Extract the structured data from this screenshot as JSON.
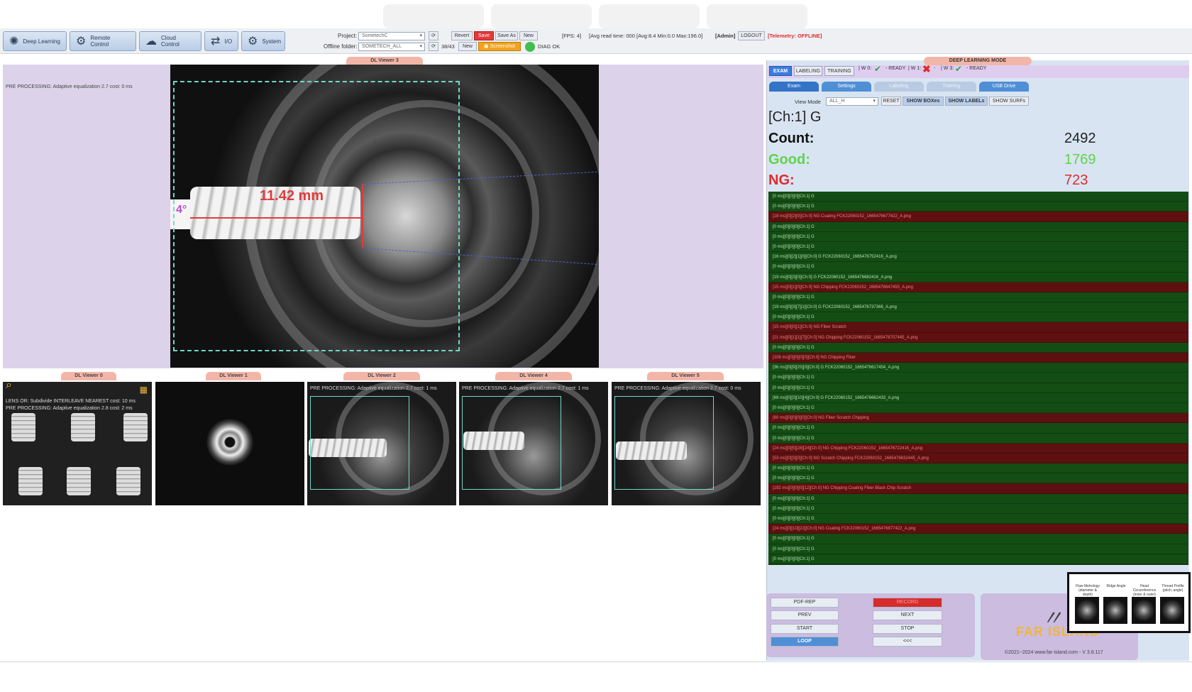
{
  "toolbar": {
    "deep_learning": "Deep Learning",
    "remote_control": "Remote Control",
    "cloud_control": "Cloud Control",
    "io": "I/O",
    "system": "System"
  },
  "project": {
    "project_label": "Project:",
    "project_value": "SometechC",
    "offline_label": "Offline folder:",
    "offline_value": "SOMETECH_ALL",
    "counter": "38/43",
    "revert": "Revert",
    "save": "Save",
    "save_as": "Save As",
    "new1": "New",
    "new2": "New",
    "screenshot": "Screenshot",
    "diag": "DIAG OK"
  },
  "status_line": {
    "fps": "[FPS: 4]",
    "avg": "[Avg read time: 000 [Avg:8.4 Min:0.0 Max:196.0]",
    "admin": "[Admin]",
    "logout": "LOGOUT",
    "telemetry": "[Telemetry: OFFLINE]"
  },
  "viewer3": {
    "tab": "DL Viewer 3",
    "preprocessing": "PRE PROCESSING: Adaptive equalization 2.7 cost: 0 ms",
    "measurement": "11.42 mm",
    "angle": "4°"
  },
  "mini_viewers": [
    {
      "tab": "DL Viewer 0",
      "pp1": "LENS OR: Subdivide INTERLEAVE NEAREST cost: 10 ms",
      "pp2": "PRE PROCESSING: Adaptive equalization 2.8 cost: 2 ms"
    },
    {
      "tab": "DL Viewer 1"
    },
    {
      "tab": "DL Viewer 2",
      "pp": "PRE PROCESSING: Adaptive equalization 2.7 cost: 1 ms"
    },
    {
      "tab": "DL Viewer 4",
      "pp": "PRE PROCESSING: Adaptive equalization 2.7 cost: 1 ms"
    },
    {
      "tab": "DL Viewer 5",
      "pp": "PRE PROCESSING: Adaptive equalization 2.7 cost: 0 ms"
    }
  ],
  "right": {
    "mode_title": "DEEP LEARNING MODE",
    "tabs": [
      "EXAM",
      "LABELING",
      "TRAINING"
    ],
    "w0": "| W 0:",
    "ready1": "- READY",
    "w1": "| W 1:",
    "dash1": "-",
    "w3": "| W 3:",
    "ready2": "- READY",
    "subtabs": [
      "Exam",
      "Settings",
      "Labeling",
      "Training",
      "USB Drive"
    ],
    "view_mode_label": "View Mode",
    "view_mode_value": "ALL_H",
    "reset": "RESET",
    "show_boxes": "SHOW BOXes",
    "show_labels": "SHOW LABELs",
    "show_surfs": "SHOW SURFs",
    "channel": "[Ch:1] G",
    "count_label": "Count:",
    "count_value": "2492",
    "good_label": "Good:",
    "good_value": "1769",
    "ng_label": "NG:",
    "ng_value": "723"
  },
  "log": [
    {
      "t": "[0 ms][0][0][0][Ch:1] G",
      "ng": false
    },
    {
      "t": "[0 ms][0][0][0][Ch:1] G",
      "ng": false
    },
    {
      "t": "[18 ms][0][2][0][Ch:0] NG Coating FCK22060152_1665476677422_A.png",
      "ng": true
    },
    {
      "t": "[0 ms][0][0][0][Ch:1] G",
      "ng": false
    },
    {
      "t": "[0 ms][0][0][0][Ch:1] G",
      "ng": false
    },
    {
      "t": "[0 ms][0][0][0][Ch:1] G",
      "ng": false
    },
    {
      "t": "[16 ms][0][2][1][0][Ch:0] G FCK22060152_1665476752416_A.png",
      "ng": false
    },
    {
      "t": "[0 ms][0][0][0][Ch:1] G",
      "ng": false
    },
    {
      "t": "[19 ms][0][3][0][Ch:0] G FCK22060152_1665476682416_A.png",
      "ng": false
    },
    {
      "t": "[15 ms][0][1][0][Ch:0] NG Chipping FCK22060152_1665476647455_A.png",
      "ng": true
    },
    {
      "t": "[0 ms][0][0][0][Ch:1] G",
      "ng": false
    },
    {
      "t": "[19 ms][0][3][7][1][Ch:0] G FCK22060152_1665476737366_A.png",
      "ng": false
    },
    {
      "t": "[0 ms][0][0][0][Ch:1] G",
      "ng": false
    },
    {
      "t": "[15 ms][0][0][1][Ch:0] NG Fiber Scratch",
      "ng": true
    },
    {
      "t": "[21 ms][0][1][1][7][Ch:0] NG Chipping FCK22060152_1665476707445_A.png",
      "ng": true
    },
    {
      "t": "[0 ms][0][0][0][Ch:1] G",
      "ng": false
    },
    {
      "t": "[108 ms][0][0][0][0][Ch:0] NG Chipping Fiber",
      "ng": true
    },
    {
      "t": "[36 ms][0][9][25][0][Ch:0] G FCK22060152_1665476617454_A.png",
      "ng": false
    },
    {
      "t": "[0 ms][0][0][0][Ch:1] G",
      "ng": false
    },
    {
      "t": "[0 ms][0][0][0][Ch:1] G",
      "ng": false
    },
    {
      "t": "[69 ms][0][3][10][4][Ch:0] G FCK22060152_1665476662433_A.png",
      "ng": false
    },
    {
      "t": "[0 ms][0][0][0][Ch:1] G",
      "ng": false
    },
    {
      "t": "[60 ms][0][0][0][0][Ch:0] NG Fiber Scratch Chipping",
      "ng": true
    },
    {
      "t": "[0 ms][0][0][0][Ch:1] G",
      "ng": false
    },
    {
      "t": "[0 ms][0][0][0][Ch:1] G",
      "ng": false
    },
    {
      "t": "[24 ms][0][5][28][24][Ch:0] NG Chipping FCK22060152_1665476722416_A.png",
      "ng": true
    },
    {
      "t": "[53 ms][0][3][0][Ch:0] NG Scratch Chipping FCK22060152_1665476632445_A.png",
      "ng": true
    },
    {
      "t": "[0 ms][0][0][0][Ch:1] G",
      "ng": false
    },
    {
      "t": "[0 ms][0][0][0][Ch:1] G",
      "ng": false
    },
    {
      "t": "[192 ms][0][0][0][12][Ch:0] NG Chipping Coating Fiber Black Chip Scratch",
      "ng": true
    },
    {
      "t": "[0 ms][0][0][0][Ch:1] G",
      "ng": false
    },
    {
      "t": "[0 ms][0][0][0][Ch:1] G",
      "ng": false
    },
    {
      "t": "[0 ms][0][0][0][Ch:1] G",
      "ng": false
    },
    {
      "t": "[24 ms][0][10][22][Ch:0] NG Coating FCK22060152_1665476677422_A.png",
      "ng": true
    },
    {
      "t": "[0 ms][0][0][0][Ch:1] G",
      "ng": false
    },
    {
      "t": "[0 ms][0][0][0][Ch:1] G",
      "ng": false
    },
    {
      "t": "[0 ms][0][0][0][Ch:1] G",
      "ng": false
    }
  ],
  "controls": {
    "pdf_rep": "PDF-REP",
    "record": "RECORD",
    "prev": "PREV",
    "next": "NEXT",
    "start": "START",
    "stop": "STOP",
    "loop": "LOOP",
    "back": "<<<"
  },
  "logo": {
    "name": "FAR ISLAND",
    "copyright": "©2021~2024 www.far-island.com - V 3.8.117"
  },
  "popup": {
    "labels": [
      "Flaw Metrology (diameter & depth)",
      "Ridge Angle",
      "Head Circumference (inner & outer)",
      "Thread Profile (pitch, angle)"
    ]
  }
}
